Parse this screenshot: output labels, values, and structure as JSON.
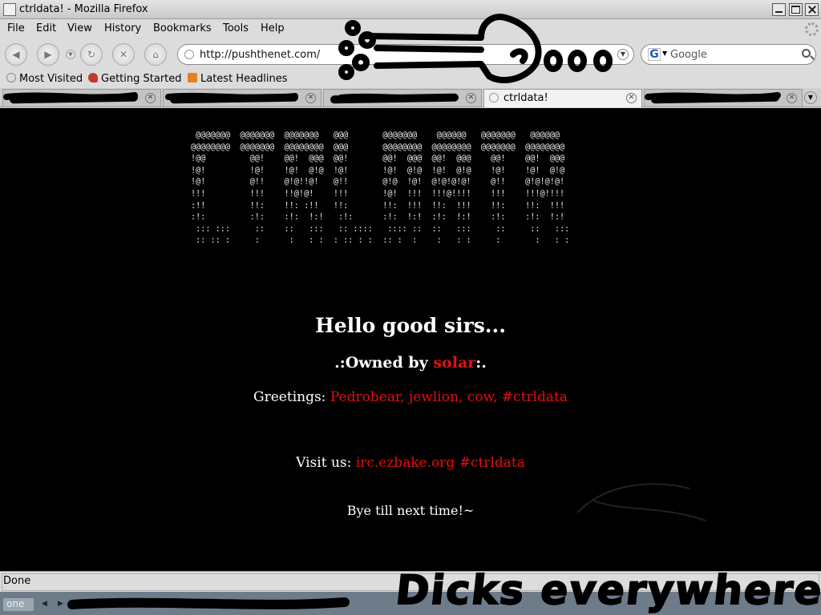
{
  "window": {
    "title": "ctrldata! - Mozilla Firefox"
  },
  "menu": {
    "items": [
      {
        "label": "File"
      },
      {
        "label": "Edit"
      },
      {
        "label": "View"
      },
      {
        "label": "History"
      },
      {
        "label": "Bookmarks"
      },
      {
        "label": "Tools"
      },
      {
        "label": "Help"
      }
    ]
  },
  "navigation": {
    "url": "http://pushthenet.com/",
    "search_placeholder": "Google",
    "search_engine_icon": "google-icon"
  },
  "bookmarks": [
    {
      "label": "Most Visited",
      "icon": "bookmark-icon"
    },
    {
      "label": "Getting Started",
      "icon": "firefox-icon"
    },
    {
      "label": "Latest Headlines",
      "icon": "rss-icon"
    }
  ],
  "tabs": [
    {
      "label": "",
      "active": false,
      "redacted": true
    },
    {
      "label": "",
      "active": false,
      "redacted": true
    },
    {
      "label": "",
      "active": false,
      "redacted": true
    },
    {
      "label": "ctrldata!",
      "active": true,
      "redacted": false
    },
    {
      "label": "",
      "active": false,
      "redacted": true
    }
  ],
  "content": {
    "ascii_art": " @@@@@@@  @@@@@@@  @@@@@@@   @@@       @@@@@@@    @@@@@@   @@@@@@@   @@@@@@\n@@@@@@@@  @@@@@@@  @@@@@@@@  @@@       @@@@@@@@  @@@@@@@@  @@@@@@@  @@@@@@@@\n!@@         @@!    @@!  @@@  @@!       @@!  @@@  @@!  @@@    @@!    @@!  @@@\n!@!         !@!    !@!  @!@  !@!       !@!  @!@  !@!  @!@    !@!    !@!  @!@\n!@!         @!!    @!@!!@!   @!!       @!@  !@!  @!@!@!@!    @!!    @!@!@!@!\n!!!         !!!    !!@!@!    !!!       !@!  !!!  !!!@!!!!    !!!    !!!@!!!!\n:!!         !!:    !!: :!!   !!:       !!:  !!!  !!:  !!!    !!:    !!:  !!!\n:!:         :!:    :!:  !:!   :!:      :!:  !:!  :!:  !:!    :!:    :!:  !:!\n ::: :::     ::    ::   :::   :: ::::   :::: ::  ::   :::     ::     ::   :::\n :: :: :     :      :   : :  : :: : :  :: :  :    :   : :     :       :   : :",
    "hello": "Hello good sirs...",
    "owned_prefix": ".:Owned by ",
    "owned_name": "solar",
    "owned_suffix": ":.",
    "greetings_label": "Greetings: ",
    "greetings_names": "Pedrobear, jewlion, cow, #ctrldata",
    "visit_label": "Visit us: ",
    "visit_link": "irc.ezbake.org #ctrldata",
    "bye": "Bye till next time!~"
  },
  "status": {
    "text": "Done"
  },
  "taskbar": {
    "desktop_label": "one"
  },
  "annotation": {
    "handwritten_text": "Dicks everywhere"
  },
  "colors": {
    "page_bg": "#000000",
    "accent_red": "#e01010",
    "chrome": "#dcdcdc"
  }
}
